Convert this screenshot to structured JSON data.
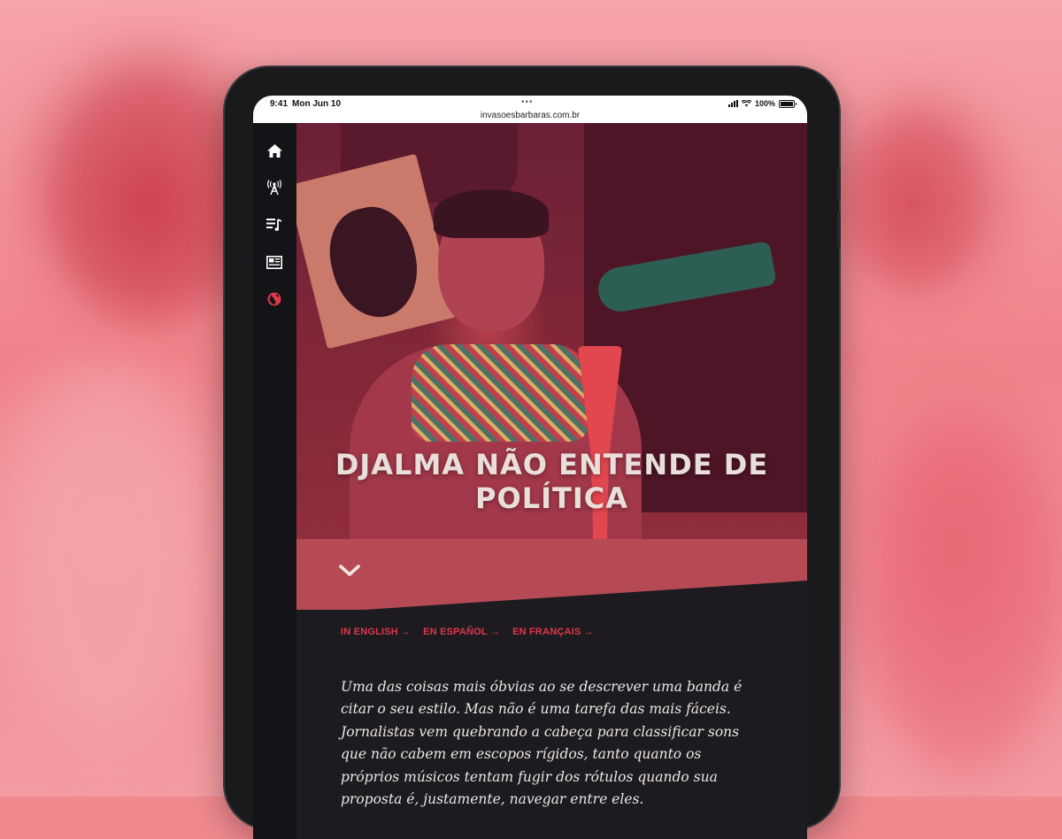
{
  "status_bar": {
    "time": "9:41",
    "date": "Mon Jun 10",
    "battery": "100%",
    "url": "invasoesbarbaras.com.br"
  },
  "nav": {
    "items": [
      {
        "icon": "home-icon"
      },
      {
        "icon": "radio-tower-icon"
      },
      {
        "icon": "playlist-icon"
      },
      {
        "icon": "newspaper-icon"
      },
      {
        "icon": "globe-icon",
        "active": true
      }
    ]
  },
  "hero": {
    "title": "DJALMA NÃO ENTENDE DE POLÍTICA",
    "scroll_icon": "chevron-down-icon"
  },
  "languages": [
    {
      "label": "IN ENGLISH",
      "arrow": "→"
    },
    {
      "label": "EN ESPAÑOL",
      "arrow": "→"
    },
    {
      "label": "EN FRANÇAIS",
      "arrow": "→"
    }
  ],
  "article": {
    "body": "Uma das coisas mais óbvias ao se descrever uma banda é citar o seu estilo. Mas não é uma tarefa das mais fáceis. Jornalistas vem quebrando a cabeça para classificar sons que não cabem em escopos rígidos, tanto quanto os próprios músicos tentam fugir dos rótulos quando sua proposta é, justamente, navegar entre eles."
  },
  "colors": {
    "accent": "#e0374a",
    "background": "#1d1b20",
    "hero_tint": "#8a2a3a",
    "page_bg": "#f08a8f"
  }
}
